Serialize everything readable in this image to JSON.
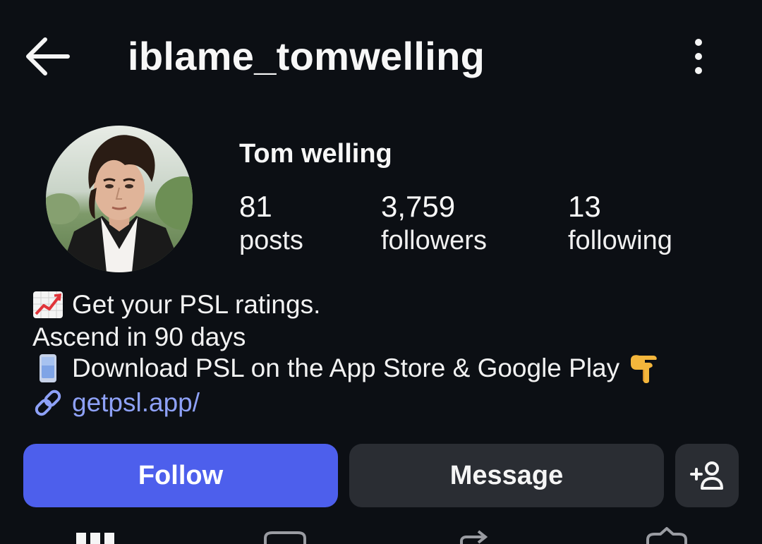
{
  "header": {
    "username": "iblame_tomwelling",
    "back_icon": "arrow-left-icon",
    "more_icon": "more-vertical-icon"
  },
  "profile": {
    "display_name": "Tom welling",
    "avatar_icon": "profile-photo",
    "stats": [
      {
        "value": "81",
        "label": "posts"
      },
      {
        "value": "3,759",
        "label": "followers"
      },
      {
        "value": "13",
        "label": "following"
      }
    ]
  },
  "bio": {
    "line1_emoji": "chart-increasing-emoji",
    "line1": "Get your PSL ratings.",
    "line2": "Ascend in 90 days",
    "line3_emoji": "mobile-phone-emoji",
    "line3": "Download PSL on the App Store & Google Play",
    "line3_trailing_emoji": "pointing-down-hand-emoji",
    "link_icon": "link-icon",
    "link": "getpsl.app/"
  },
  "actions": {
    "follow_label": "Follow",
    "message_label": "Message",
    "suggest_icon": "add-person-icon"
  },
  "tabs": [
    {
      "icon": "grid-icon"
    },
    {
      "icon": "reels-icon"
    },
    {
      "icon": "reposts-icon"
    },
    {
      "icon": "tagged-icon"
    }
  ],
  "colors": {
    "background": "#0c0f14",
    "accent": "#4d5fec",
    "secondary_button": "#2a2d33",
    "link": "#8ea1f7"
  }
}
